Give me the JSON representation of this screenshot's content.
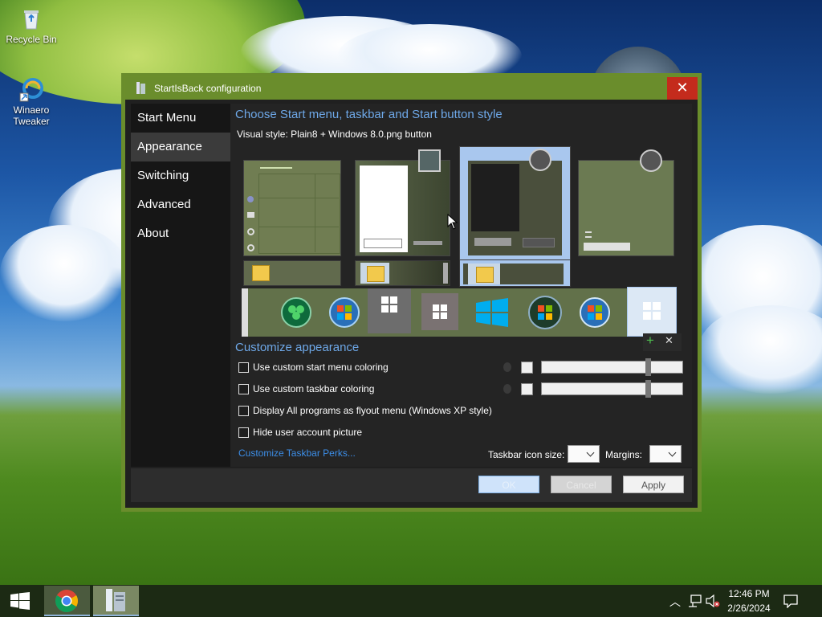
{
  "desktop": {
    "icons": [
      {
        "label": "Recycle Bin",
        "icon": "recycle-bin-icon"
      },
      {
        "label": "Winaero Tweaker",
        "icon": "winaero-tweaker-icon"
      }
    ]
  },
  "window": {
    "title": "StartIsBack configuration",
    "close_label": "✕",
    "sidebar": {
      "items": [
        {
          "label": "Start Menu"
        },
        {
          "label": "Appearance",
          "selected": true
        },
        {
          "label": "Switching"
        },
        {
          "label": "Advanced"
        },
        {
          "label": "About"
        }
      ]
    },
    "appearance": {
      "heading": "Choose Start menu, taskbar and Start button style",
      "visual_style": "Visual style:  Plain8 + Windows 8.0.png button",
      "orb_actions": {
        "add": "+",
        "remove": "✕"
      },
      "customize_heading": "Customize appearance",
      "options": [
        {
          "label": "Use custom start menu coloring",
          "checked": false
        },
        {
          "label": "Use custom taskbar coloring",
          "checked": false
        },
        {
          "label": "Display All programs as flyout menu (Windows XP style)",
          "checked": false
        },
        {
          "label": "Hide user account picture",
          "checked": false
        }
      ],
      "link": "Customize Taskbar Perks...",
      "icon_size_label": "Taskbar icon size:",
      "margins_label": "Margins:",
      "slider_start_menu": 0.75,
      "slider_taskbar": 0.75
    },
    "buttons": {
      "ok": "OK",
      "cancel": "Cancel",
      "apply": "Apply"
    }
  },
  "taskbar": {
    "time": "12:46 PM",
    "date": "2/26/2024"
  },
  "colors": {
    "accent": "#6a8d2c",
    "close": "#c42b1c",
    "link": "#3c8ee8",
    "heading": "#6ea8e8"
  }
}
